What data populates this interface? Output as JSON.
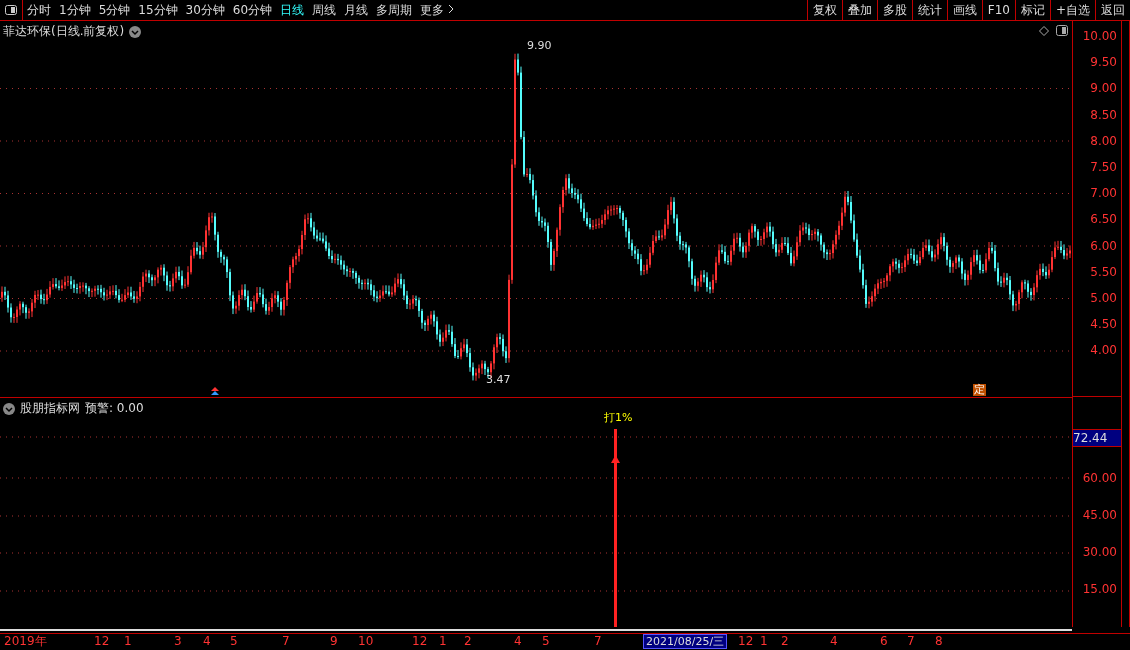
{
  "toolbar": {
    "periods": [
      {
        "label": "分时",
        "selected": false
      },
      {
        "label": "1分钟",
        "selected": false
      },
      {
        "label": "5分钟",
        "selected": false
      },
      {
        "label": "15分钟",
        "selected": false
      },
      {
        "label": "30分钟",
        "selected": false
      },
      {
        "label": "60分钟",
        "selected": false
      },
      {
        "label": "日线",
        "selected": true
      },
      {
        "label": "周线",
        "selected": false
      },
      {
        "label": "月线",
        "selected": false
      },
      {
        "label": "多周期",
        "selected": false
      }
    ],
    "more": "更多",
    "buttons": [
      "复权",
      "叠加",
      "多股",
      "统计",
      "画线",
      "F10",
      "标记",
      "+自选",
      "返回"
    ]
  },
  "chart": {
    "title": "菲达环保(日线.前复权)",
    "high_label": "9.90",
    "low_label": "3.47",
    "marker": "定",
    "price_axis": [
      "10.00",
      "9.50",
      "9.00",
      "8.50",
      "8.00",
      "7.50",
      "7.00",
      "6.50",
      "6.00",
      "5.50",
      "5.00",
      "4.50",
      "4.00"
    ]
  },
  "indicator": {
    "title": "股朋指标网",
    "alert": "预警: 0.00",
    "signal_label": "打1%",
    "current_value": "72.44",
    "axis": [
      "60.00",
      "45.00",
      "30.00",
      "15.00"
    ]
  },
  "time_axis": [
    {
      "label": "2019年",
      "selected": false
    },
    {
      "label": "12",
      "selected": false
    },
    {
      "label": "1",
      "selected": false
    },
    {
      "label": "3",
      "selected": false
    },
    {
      "label": "4",
      "selected": false
    },
    {
      "label": "5",
      "selected": false
    },
    {
      "label": "7",
      "selected": false
    },
    {
      "label": "9",
      "selected": false
    },
    {
      "label": "10",
      "selected": false
    },
    {
      "label": "12",
      "selected": false
    },
    {
      "label": "1",
      "selected": false
    },
    {
      "label": "2",
      "selected": false
    },
    {
      "label": "4",
      "selected": false
    },
    {
      "label": "5",
      "selected": false
    },
    {
      "label": "7",
      "selected": false
    },
    {
      "label": "2021/08/25/三",
      "selected": true
    },
    {
      "label": "12",
      "selected": false
    },
    {
      "label": "1",
      "selected": false
    },
    {
      "label": "2",
      "selected": false
    },
    {
      "label": "4",
      "selected": false
    },
    {
      "label": "6",
      "selected": false
    },
    {
      "label": "7",
      "selected": false
    },
    {
      "label": "8",
      "selected": false
    }
  ]
}
